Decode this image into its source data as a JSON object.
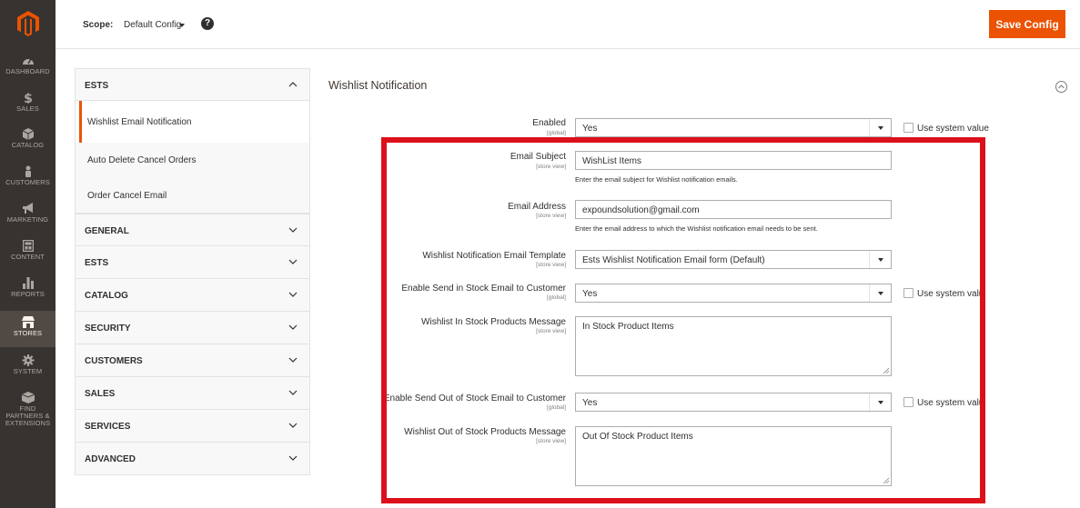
{
  "nav": {
    "items": [
      {
        "label": "DASHBOARD",
        "icon": "gauge-icon"
      },
      {
        "label": "SALES",
        "icon": "dollar-icon"
      },
      {
        "label": "CATALOG",
        "icon": "cube-icon"
      },
      {
        "label": "CUSTOMERS",
        "icon": "person-icon"
      },
      {
        "label": "MARKETING",
        "icon": "megaphone-icon"
      },
      {
        "label": "CONTENT",
        "icon": "layout-icon"
      },
      {
        "label": "REPORTS",
        "icon": "bar-chart-icon"
      },
      {
        "label": "STORES",
        "icon": "store-icon"
      },
      {
        "label": "SYSTEM",
        "icon": "gear-icon"
      },
      {
        "label": "FIND PARTNERS & EXTENSIONS",
        "icon": "box-icon"
      }
    ],
    "active": "STORES"
  },
  "header": {
    "scope_label": "Scope:",
    "scope_value": "Default Config",
    "help": "?",
    "save_label": "Save Config"
  },
  "sidebar": {
    "open_group": "ESTS",
    "open_items": [
      "Wishlist Email Notification",
      "Auto Delete Cancel Orders",
      "Order Cancel Email"
    ],
    "groups": [
      "GENERAL",
      "ESTS",
      "CATALOG",
      "SECURITY",
      "CUSTOMERS",
      "SALES",
      "SERVICES",
      "ADVANCED"
    ]
  },
  "section": {
    "title": "Wishlist Notification"
  },
  "fields": {
    "enabled": {
      "label": "Enabled",
      "scope": "[global]",
      "value": "Yes",
      "system": "Use system value"
    },
    "email_subject": {
      "label": "Email Subject",
      "scope": "[store view]",
      "value": "WishList Items",
      "note": "Enter the email subject for Wishlist notification emails."
    },
    "email_address": {
      "label": "Email Address",
      "scope": "[store view]",
      "value": "expoundsolution@gmail.com",
      "note": "Enter the email address to which the Wishlist notification email needs to be sent."
    },
    "template": {
      "label": "Wishlist Notification Email Template",
      "scope": "[store view]",
      "value": "Ests Wishlist Notification Email form (Default)"
    },
    "in_stock_enable": {
      "label": "Enable Send in Stock Email to Customer",
      "scope": "[global]",
      "value": "Yes",
      "system": "Use system valu"
    },
    "in_stock_msg": {
      "label": "Wishlist In Stock Products Message",
      "scope": "[store view]",
      "value": "In Stock Product Items"
    },
    "out_stock_enable": {
      "label": "Enable Send Out of Stock Email to Customer",
      "scope": "[global]",
      "value": "Yes",
      "system": "Use system valu"
    },
    "out_stock_msg": {
      "label": "Wishlist Out of Stock Products Message",
      "scope": "[store view]",
      "value": "Out Of Stock Product Items"
    }
  },
  "colors": {
    "accent": "#eb5202",
    "nav_bg": "#373330",
    "highlight": "#dc101a"
  }
}
